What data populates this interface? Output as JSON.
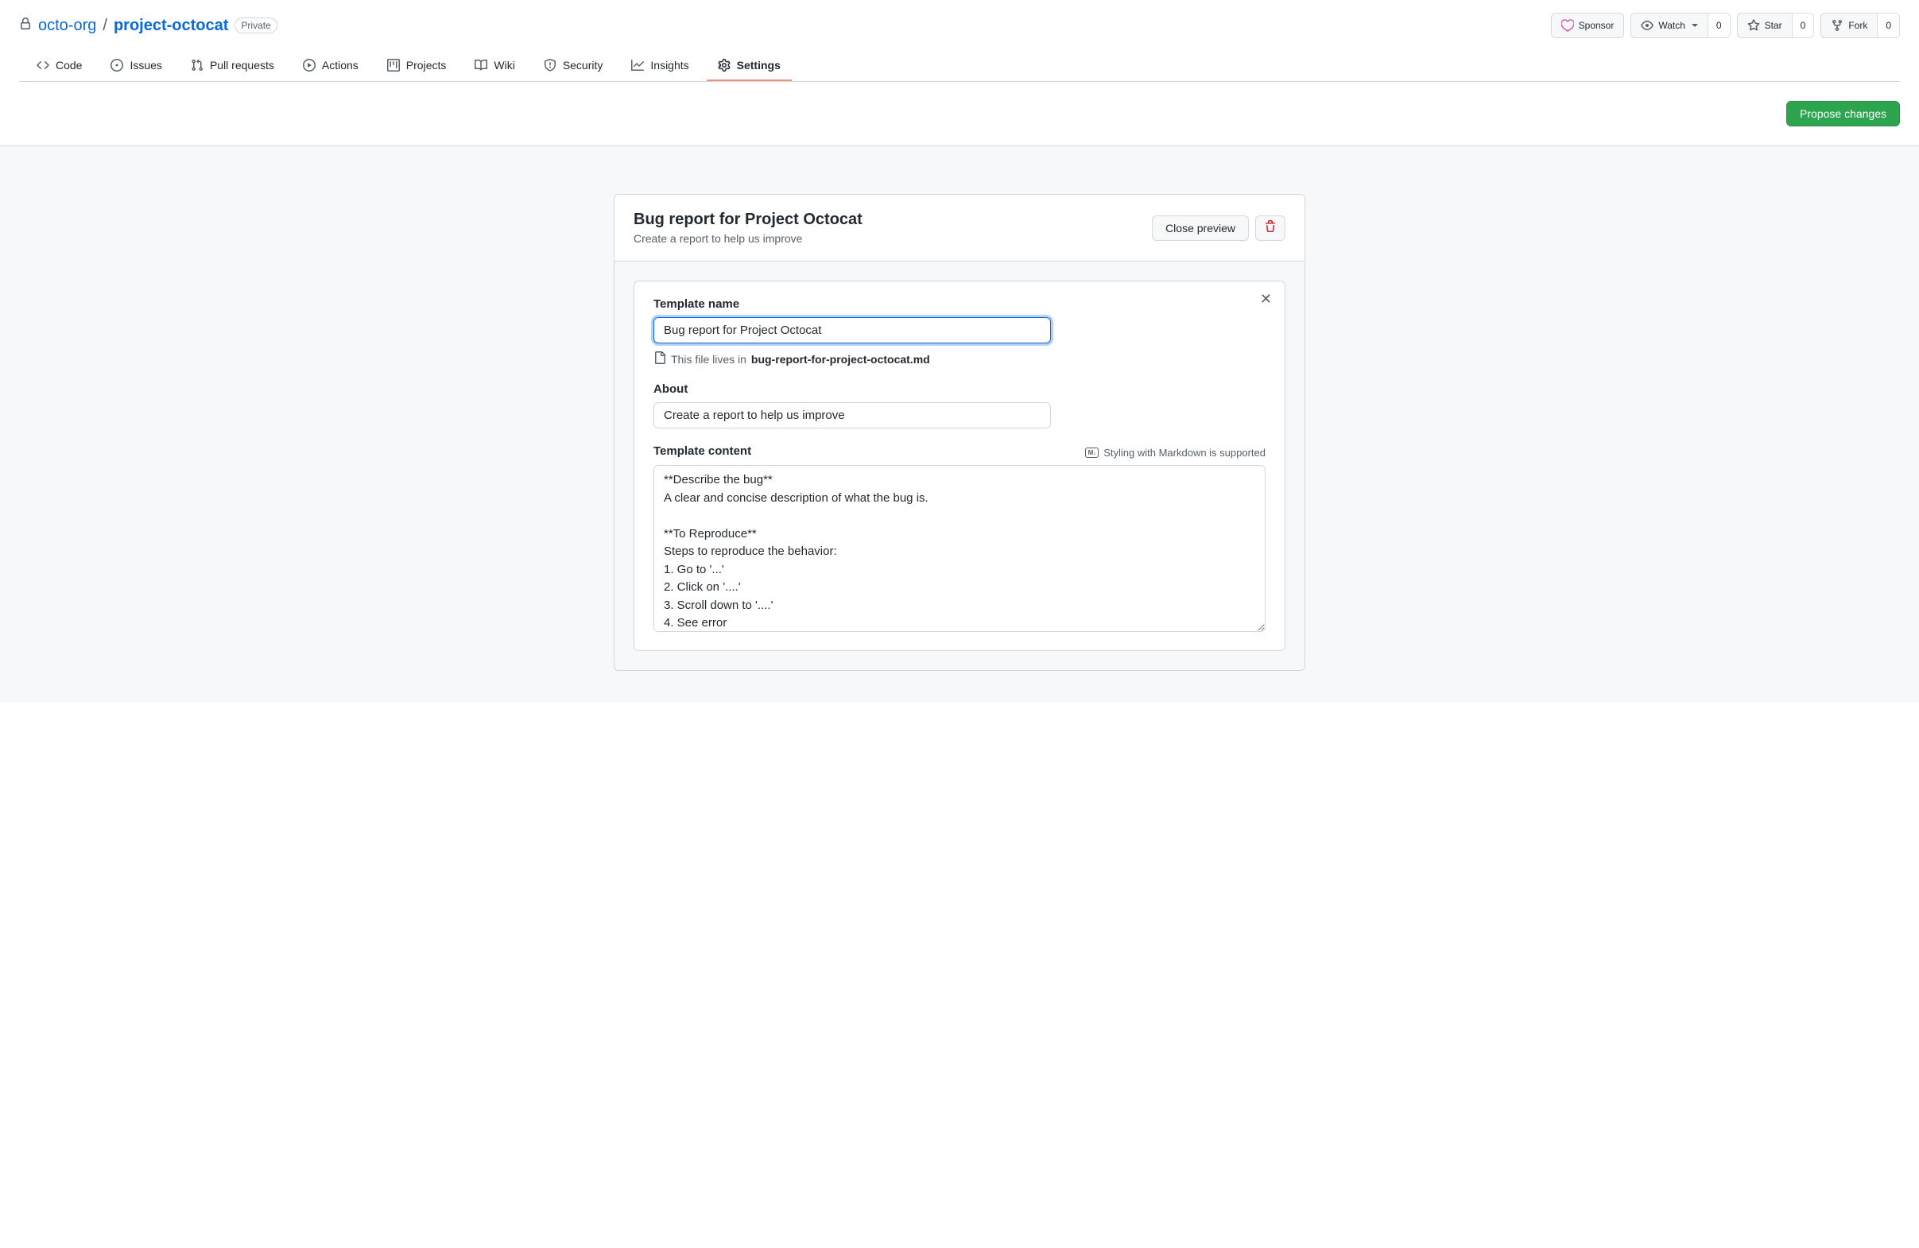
{
  "repo": {
    "org": "octo-org",
    "name": "project-octocat",
    "visibility": "Private"
  },
  "actions": {
    "sponsor": "Sponsor",
    "watch": "Watch",
    "watch_count": "0",
    "star": "Star",
    "star_count": "0",
    "fork": "Fork",
    "fork_count": "0"
  },
  "tabs": {
    "code": "Code",
    "issues": "Issues",
    "pulls": "Pull requests",
    "actions": "Actions",
    "projects": "Projects",
    "wiki": "Wiki",
    "security": "Security",
    "insights": "Insights",
    "settings": "Settings"
  },
  "propose_button": "Propose changes",
  "template": {
    "title": "Bug report for Project Octocat",
    "subtitle": "Create a report to help us improve",
    "close_preview": "Close preview"
  },
  "form": {
    "name_label": "Template name",
    "name_value": "Bug report for Project Octocat",
    "file_hint_prefix": "This file lives in ",
    "file_name": "bug-report-for-project-octocat.md",
    "about_label": "About",
    "about_value": "Create a report to help us improve",
    "content_label": "Template content",
    "markdown_hint": "Styling with Markdown is supported",
    "content_value": "**Describe the bug**\nA clear and concise description of what the bug is.\n\n**To Reproduce**\nSteps to reproduce the behavior:\n1. Go to '...'\n2. Click on '....'\n3. Scroll down to '....'\n4. See error"
  }
}
